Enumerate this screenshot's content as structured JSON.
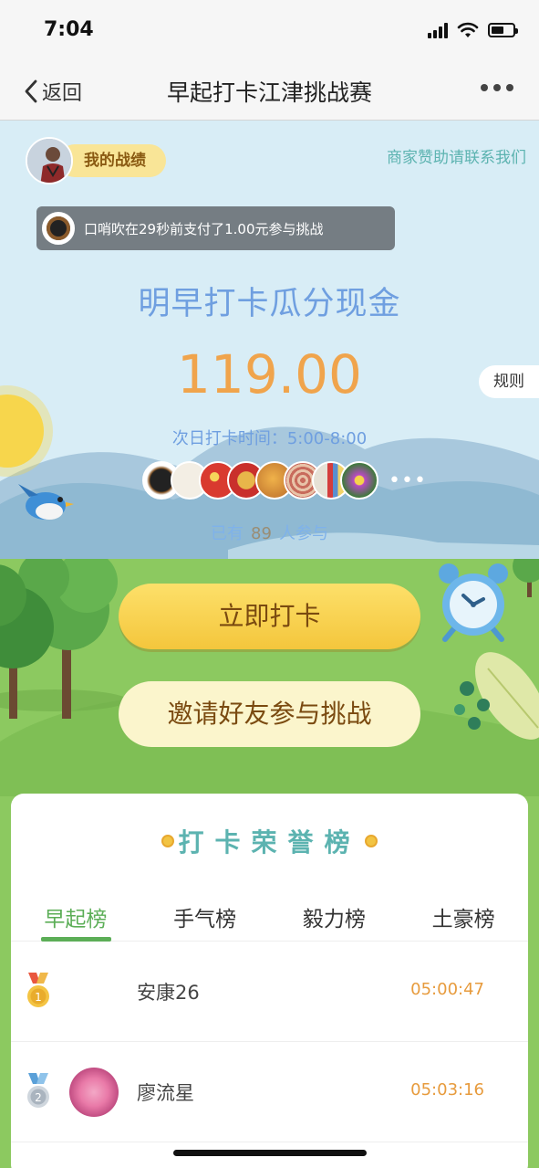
{
  "status_bar": {
    "time": "7:04",
    "battery_level": 0.6
  },
  "nav": {
    "back_label": "返回",
    "title": "早起打卡江津挑战赛"
  },
  "hero": {
    "my_record_label": "我的战绩",
    "sponsor_link": "商家赞助请联系我们",
    "ticker_text": "口哨吹在29秒前支付了1.00元参与挑战",
    "headline": "明早打卡瓜分现金",
    "amount": "119.00",
    "rules_label": "规则",
    "checkin_time": "次日打卡时间：5:00-8:00",
    "more_dots": "•••",
    "joined_prefix": "已有",
    "joined_count": "89",
    "joined_suffix": "人参与"
  },
  "actions": {
    "checkin_label": "立即打卡",
    "invite_label": "邀请好友参与挑战"
  },
  "board": {
    "title": "打卡荣誉榜",
    "tabs": [
      {
        "label": "早起榜",
        "active": true
      },
      {
        "label": "手气榜",
        "active": false
      },
      {
        "label": "毅力榜",
        "active": false
      },
      {
        "label": "土豪榜",
        "active": false
      }
    ],
    "rows": [
      {
        "rank": "1",
        "name": "安康26",
        "time": "05:00:47",
        "medal": "gold"
      },
      {
        "rank": "2",
        "name": "廖流星",
        "time": "05:03:16",
        "medal": "silver"
      }
    ]
  },
  "colors": {
    "accent_green": "#5cae57",
    "amount_orange": "#f0a44c",
    "headline_blue": "#6f9fe0",
    "sky": "#d8edf6",
    "grass": "#8cc960",
    "checkin_button": "#f4c63c"
  }
}
